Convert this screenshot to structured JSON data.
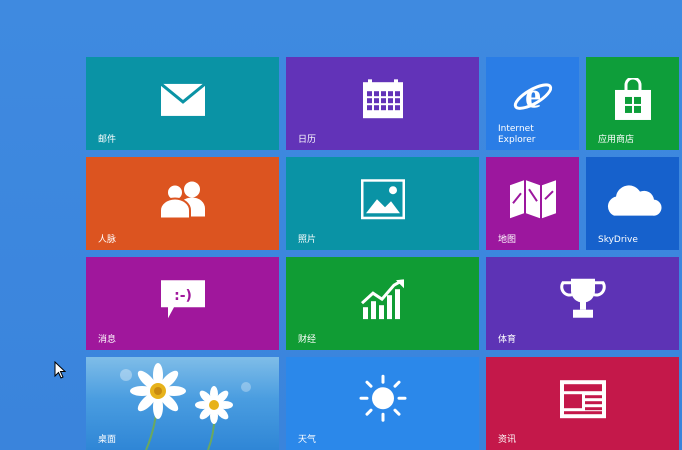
{
  "tiles": {
    "mail": {
      "label": "邮件",
      "color": "#0a93a5",
      "icon": "envelope-icon"
    },
    "calendar": {
      "label": "日历",
      "color": "#6233b8",
      "icon": "calendar-icon"
    },
    "ie": {
      "label": "Internet\nExplorer",
      "color": "#2a7de6",
      "icon": "internet-explorer-icon"
    },
    "store": {
      "label": "应用商店",
      "color": "#0e9e3a",
      "icon": "store-bag-icon"
    },
    "people": {
      "label": "人脉",
      "color": "#dc5420",
      "icon": "people-icon"
    },
    "photos": {
      "label": "照片",
      "color": "#0a93a5",
      "icon": "photo-icon"
    },
    "maps": {
      "label": "地图",
      "color": "#9c179e",
      "icon": "map-icon"
    },
    "skydrive": {
      "label": "SkyDrive",
      "color": "#1661cc",
      "icon": "cloud-icon"
    },
    "messaging": {
      "label": "消息",
      "color": "#a0179c",
      "icon": "chat-bubble-icon"
    },
    "finance": {
      "label": "财经",
      "color": "#109c34",
      "icon": "chart-up-icon"
    },
    "sports": {
      "label": "体育",
      "color": "#5d33b5",
      "icon": "trophy-icon"
    },
    "desktop": {
      "label": "桌面",
      "color": "#4a9de0",
      "icon": "daisy-wallpaper"
    },
    "weather": {
      "label": "天气",
      "color": "#2b88ea",
      "icon": "sun-icon"
    },
    "news": {
      "label": "资讯",
      "color": "#c4184a",
      "icon": "newspaper-icon"
    }
  }
}
